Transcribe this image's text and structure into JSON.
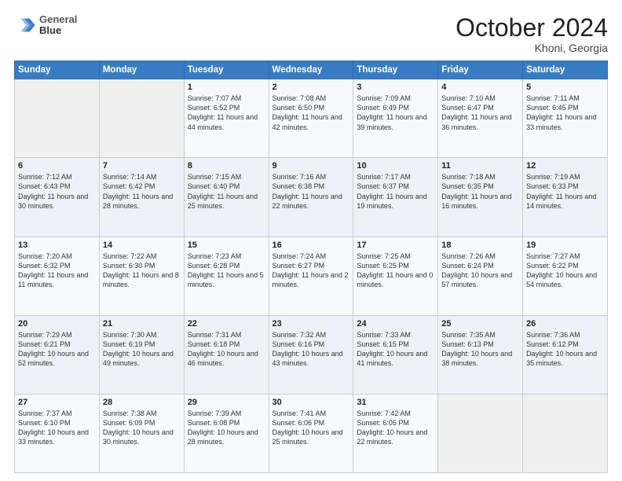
{
  "logo": {
    "line1": "General",
    "line2": "Blue"
  },
  "header": {
    "month": "October 2024",
    "location": "Khoni, Georgia"
  },
  "weekdays": [
    "Sunday",
    "Monday",
    "Tuesday",
    "Wednesday",
    "Thursday",
    "Friday",
    "Saturday"
  ],
  "weeks": [
    [
      {
        "day": "",
        "info": ""
      },
      {
        "day": "",
        "info": ""
      },
      {
        "day": "1",
        "info": "Sunrise: 7:07 AM\nSunset: 6:52 PM\nDaylight: 11 hours and 44 minutes."
      },
      {
        "day": "2",
        "info": "Sunrise: 7:08 AM\nSunset: 6:50 PM\nDaylight: 11 hours and 42 minutes."
      },
      {
        "day": "3",
        "info": "Sunrise: 7:09 AM\nSunset: 6:49 PM\nDaylight: 11 hours and 39 minutes."
      },
      {
        "day": "4",
        "info": "Sunrise: 7:10 AM\nSunset: 6:47 PM\nDaylight: 11 hours and 36 minutes."
      },
      {
        "day": "5",
        "info": "Sunrise: 7:11 AM\nSunset: 6:45 PM\nDaylight: 11 hours and 33 minutes."
      }
    ],
    [
      {
        "day": "6",
        "info": "Sunrise: 7:12 AM\nSunset: 6:43 PM\nDaylight: 11 hours and 30 minutes."
      },
      {
        "day": "7",
        "info": "Sunrise: 7:14 AM\nSunset: 6:42 PM\nDaylight: 11 hours and 28 minutes."
      },
      {
        "day": "8",
        "info": "Sunrise: 7:15 AM\nSunset: 6:40 PM\nDaylight: 11 hours and 25 minutes."
      },
      {
        "day": "9",
        "info": "Sunrise: 7:16 AM\nSunset: 6:38 PM\nDaylight: 11 hours and 22 minutes."
      },
      {
        "day": "10",
        "info": "Sunrise: 7:17 AM\nSunset: 6:37 PM\nDaylight: 11 hours and 19 minutes."
      },
      {
        "day": "11",
        "info": "Sunrise: 7:18 AM\nSunset: 6:35 PM\nDaylight: 11 hours and 16 minutes."
      },
      {
        "day": "12",
        "info": "Sunrise: 7:19 AM\nSunset: 6:33 PM\nDaylight: 11 hours and 14 minutes."
      }
    ],
    [
      {
        "day": "13",
        "info": "Sunrise: 7:20 AM\nSunset: 6:32 PM\nDaylight: 11 hours and 11 minutes."
      },
      {
        "day": "14",
        "info": "Sunrise: 7:22 AM\nSunset: 6:30 PM\nDaylight: 11 hours and 8 minutes."
      },
      {
        "day": "15",
        "info": "Sunrise: 7:23 AM\nSunset: 6:28 PM\nDaylight: 11 hours and 5 minutes."
      },
      {
        "day": "16",
        "info": "Sunrise: 7:24 AM\nSunset: 6:27 PM\nDaylight: 11 hours and 2 minutes."
      },
      {
        "day": "17",
        "info": "Sunrise: 7:25 AM\nSunset: 6:25 PM\nDaylight: 11 hours and 0 minutes."
      },
      {
        "day": "18",
        "info": "Sunrise: 7:26 AM\nSunset: 6:24 PM\nDaylight: 10 hours and 57 minutes."
      },
      {
        "day": "19",
        "info": "Sunrise: 7:27 AM\nSunset: 6:22 PM\nDaylight: 10 hours and 54 minutes."
      }
    ],
    [
      {
        "day": "20",
        "info": "Sunrise: 7:29 AM\nSunset: 6:21 PM\nDaylight: 10 hours and 52 minutes."
      },
      {
        "day": "21",
        "info": "Sunrise: 7:30 AM\nSunset: 6:19 PM\nDaylight: 10 hours and 49 minutes."
      },
      {
        "day": "22",
        "info": "Sunrise: 7:31 AM\nSunset: 6:18 PM\nDaylight: 10 hours and 46 minutes."
      },
      {
        "day": "23",
        "info": "Sunrise: 7:32 AM\nSunset: 6:16 PM\nDaylight: 10 hours and 43 minutes."
      },
      {
        "day": "24",
        "info": "Sunrise: 7:33 AM\nSunset: 6:15 PM\nDaylight: 10 hours and 41 minutes."
      },
      {
        "day": "25",
        "info": "Sunrise: 7:35 AM\nSunset: 6:13 PM\nDaylight: 10 hours and 38 minutes."
      },
      {
        "day": "26",
        "info": "Sunrise: 7:36 AM\nSunset: 6:12 PM\nDaylight: 10 hours and 35 minutes."
      }
    ],
    [
      {
        "day": "27",
        "info": "Sunrise: 7:37 AM\nSunset: 6:10 PM\nDaylight: 10 hours and 33 minutes."
      },
      {
        "day": "28",
        "info": "Sunrise: 7:38 AM\nSunset: 6:09 PM\nDaylight: 10 hours and 30 minutes."
      },
      {
        "day": "29",
        "info": "Sunrise: 7:39 AM\nSunset: 6:08 PM\nDaylight: 10 hours and 28 minutes."
      },
      {
        "day": "30",
        "info": "Sunrise: 7:41 AM\nSunset: 6:06 PM\nDaylight: 10 hours and 25 minutes."
      },
      {
        "day": "31",
        "info": "Sunrise: 7:42 AM\nSunset: 6:05 PM\nDaylight: 10 hours and 22 minutes."
      },
      {
        "day": "",
        "info": ""
      },
      {
        "day": "",
        "info": ""
      }
    ]
  ]
}
